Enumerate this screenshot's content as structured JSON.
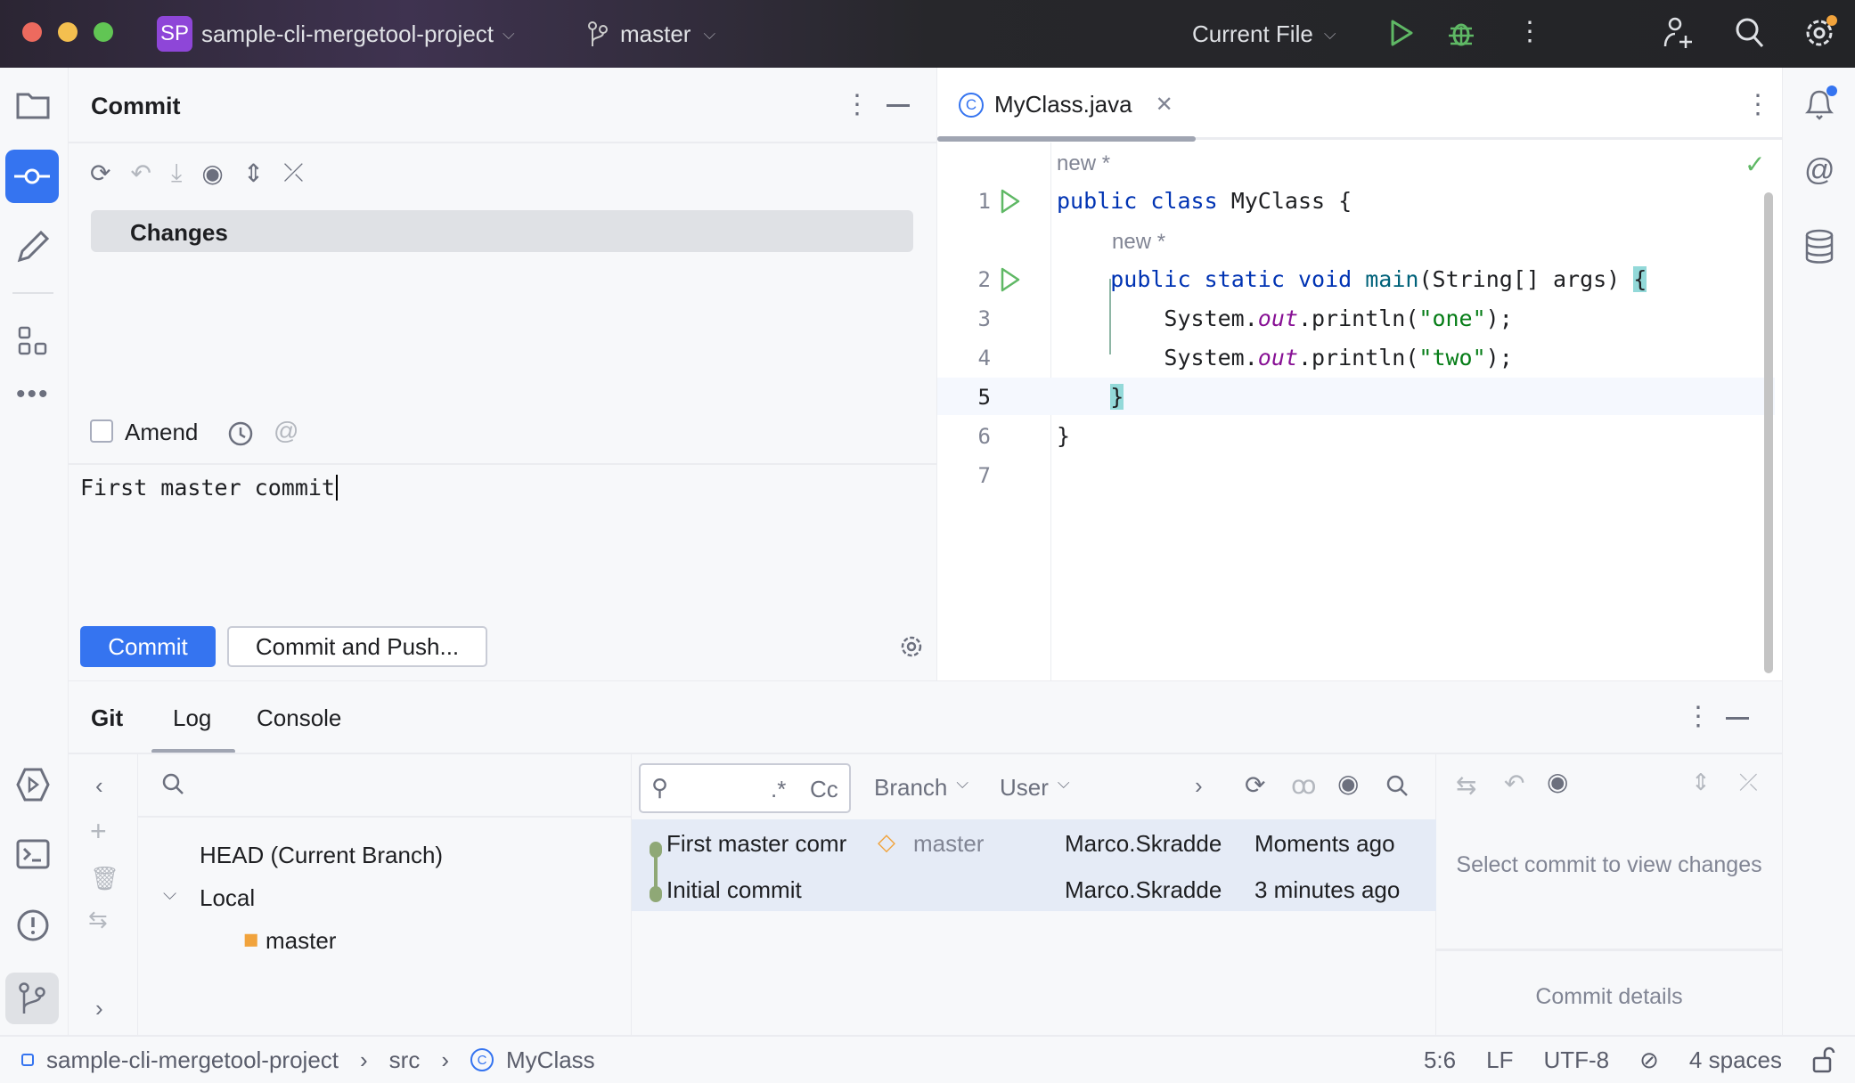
{
  "titlebar": {
    "project_badge": "SP",
    "project": "sample-cli-mergetool-project",
    "branch": "master",
    "run_config": "Current File"
  },
  "commit_panel": {
    "title": "Commit",
    "changes_label": "Changes",
    "amend_label": "Amend",
    "amend_checked": false,
    "message": "First master commit",
    "commit_button": "Commit",
    "commit_push_button": "Commit and Push..."
  },
  "editor": {
    "tab": "MyClass.java",
    "hint": "new *",
    "lines": [
      {
        "n": "1"
      },
      {
        "n": "2"
      },
      {
        "n": "3"
      },
      {
        "n": "4"
      },
      {
        "n": "5"
      },
      {
        "n": "6"
      },
      {
        "n": "7"
      }
    ],
    "code": {
      "l1a": "public",
      "l1b": "class",
      "l1c": " MyClass {",
      "l2a": "public",
      "l2b": "static",
      "l2c": "void",
      "l2d": "main",
      "l2e": "(String[] args) ",
      "l2f": "{",
      "l3a": "System.",
      "l3b": "out",
      "l3c": ".println(",
      "l3d": "\"one\"",
      "l3e": ");",
      "l4d": "\"two\"",
      "l5": "}",
      "l6": "}"
    }
  },
  "bottom": {
    "tabs": [
      "Git",
      "Log",
      "Console"
    ],
    "active_tab": "Log",
    "tree": {
      "head": "HEAD (Current Branch)",
      "local": "Local",
      "master": "master"
    },
    "filters": {
      "regex": ".*",
      "case": "Cc",
      "branch": "Branch",
      "user": "User"
    },
    "commits": [
      {
        "message": "First master comr",
        "tag": "master",
        "author": "Marco.Skradde",
        "date": "Moments ago"
      },
      {
        "message": "Initial commit",
        "author": "Marco.Skradde",
        "date": "3 minutes ago"
      }
    ],
    "details_empty": "Select commit to view changes",
    "details_label": "Commit details"
  },
  "statusbar": {
    "crumbs": [
      "sample-cli-mergetool-project",
      "src",
      "MyClass"
    ],
    "position": "5:6",
    "line_sep": "LF",
    "encoding": "UTF-8",
    "indent": "4 spaces"
  },
  "colors": {
    "accent": "#3574f0",
    "badge": "#8e46d8",
    "run": "#5fb865"
  }
}
